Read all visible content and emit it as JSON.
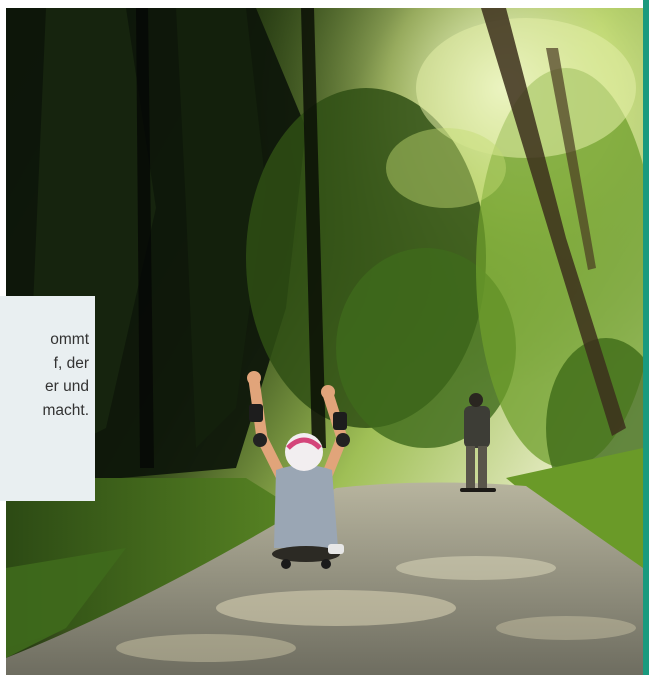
{
  "caption": {
    "lines": [
      "ommt",
      "f, der",
      "er und",
      "macht."
    ]
  },
  "photo": {
    "subject": "Zwei Longboarder auf einem Waldweg"
  },
  "colors": {
    "accent": "#1a9a7e",
    "caption_bg": "#e9eff1",
    "caption_text": "#333333"
  }
}
